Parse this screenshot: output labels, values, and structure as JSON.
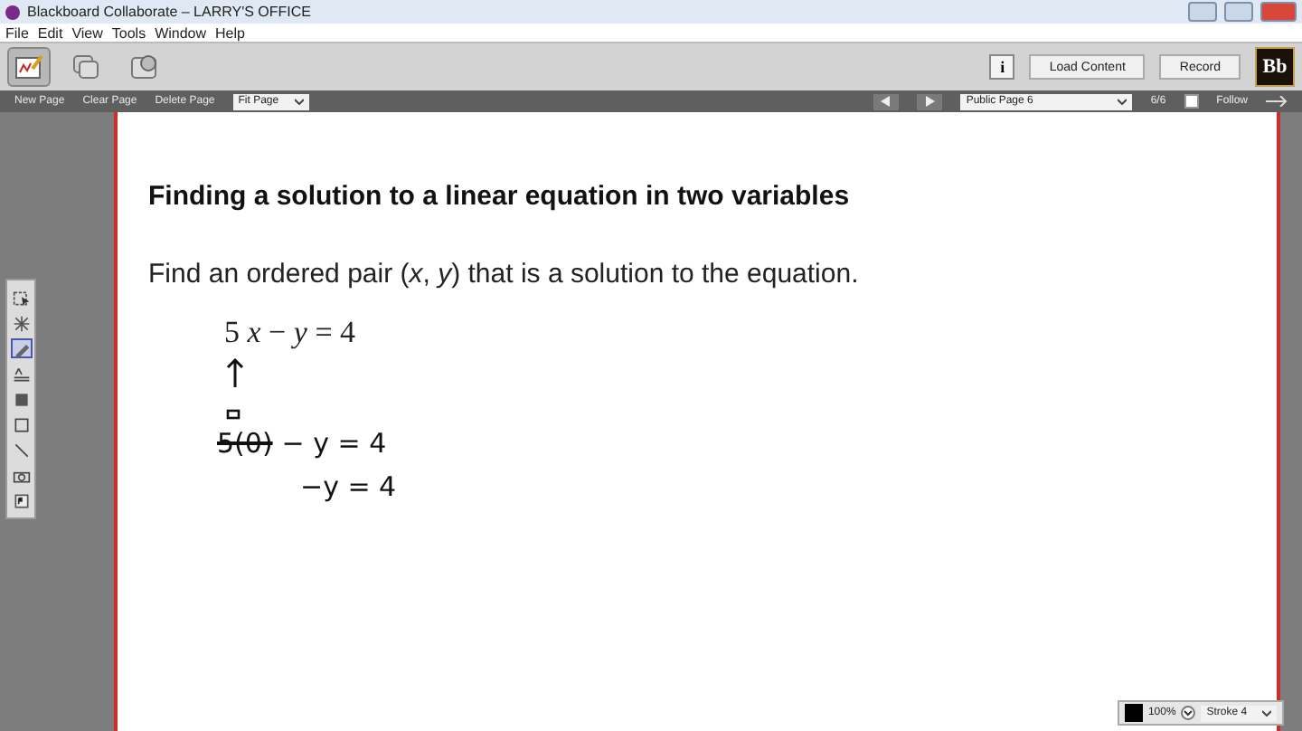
{
  "window": {
    "title": "Blackboard Collaborate – LARRY'S OFFICE"
  },
  "menu": [
    "File",
    "Edit",
    "View",
    "Tools",
    "Window",
    "Help"
  ],
  "toolbar": {
    "modes": [
      {
        "kind": "whiteboard",
        "selected": true
      },
      {
        "kind": "app-share",
        "selected": false
      },
      {
        "kind": "web-tour",
        "selected": false
      }
    ],
    "info": "i",
    "buttons": [
      "Load Content",
      "Record"
    ],
    "logo": "Bb"
  },
  "page_bar": {
    "actions": [
      "New Page",
      "Clear Page",
      "Delete Page"
    ],
    "fit": "Fit Page",
    "page": "Public Page 6",
    "count": "6/6",
    "follow": {
      "label": "Follow",
      "checked": false
    }
  },
  "tools": [
    {
      "kind": "select",
      "selected": false
    },
    {
      "kind": "laser",
      "selected": false
    },
    {
      "kind": "pencil",
      "selected": true
    },
    {
      "kind": "text",
      "selected": false
    },
    {
      "kind": "filled-rect",
      "selected": false
    },
    {
      "kind": "rect",
      "selected": false
    },
    {
      "kind": "line",
      "selected": false
    },
    {
      "kind": "camera",
      "selected": false
    },
    {
      "kind": "clipart",
      "selected": false
    }
  ],
  "content": {
    "heading": "Finding a solution to a linear equation in two variables",
    "prompt": "Find an ordered pair (*x*,  *y*) that is a solution to the equation.",
    "equation": "5 *x* − *y* = 4",
    "ink": [
      [
        {
          "text": "5(0)",
          "struck": true
        },
        {
          "text": "− y = 4",
          "struck": false
        }
      ],
      [
        {
          "text": "−y = 4",
          "struck": false
        }
      ]
    ]
  },
  "properties": {
    "zoom": "100%",
    "stroke": "Stroke 4"
  }
}
